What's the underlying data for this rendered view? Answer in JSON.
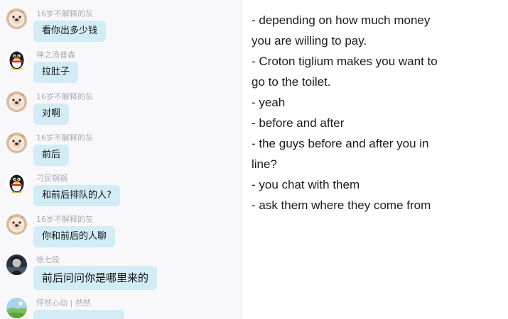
{
  "chat": {
    "messages": [
      {
        "sender": "16岁不解释的灰",
        "avatar": "dog-avatar-icon",
        "text": "看你出多少钱"
      },
      {
        "sender": "神之汤普森",
        "avatar": "penguin-avatar-icon",
        "text": "拉肚子"
      },
      {
        "sender": "16岁不解释的灰",
        "avatar": "dog-avatar-icon",
        "text": "对啊"
      },
      {
        "sender": "16岁不解释的灰",
        "avatar": "dog-avatar-icon",
        "text": "前后"
      },
      {
        "sender": "刁民锅锅",
        "avatar": "penguin-avatar-icon",
        "text": "和前后排队的人?"
      },
      {
        "sender": "16岁不解释的灰",
        "avatar": "dog-avatar-icon",
        "text": "你和前后的人聊"
      },
      {
        "sender": "徐七段",
        "avatar": "portrait-avatar-icon",
        "text": "前后问问你是哪里来的"
      },
      {
        "sender": "怦然心动 | 然然",
        "avatar": "landscape-avatar-icon",
        "text": ""
      }
    ]
  },
  "translation": {
    "lines": [
      "- depending on how much money",
      "you are willing to pay.",
      "- Croton tiglium makes you want to",
      "go to the toilet.",
      "- yeah",
      "- before and after",
      "- the guys before and after you in",
      "line?",
      "- you chat with them",
      "- ask them where they come from"
    ]
  },
  "colors": {
    "bubble": "#d2ecf6",
    "sender_name": "#a9a9b8",
    "panel_background": "#f8f8fa"
  }
}
